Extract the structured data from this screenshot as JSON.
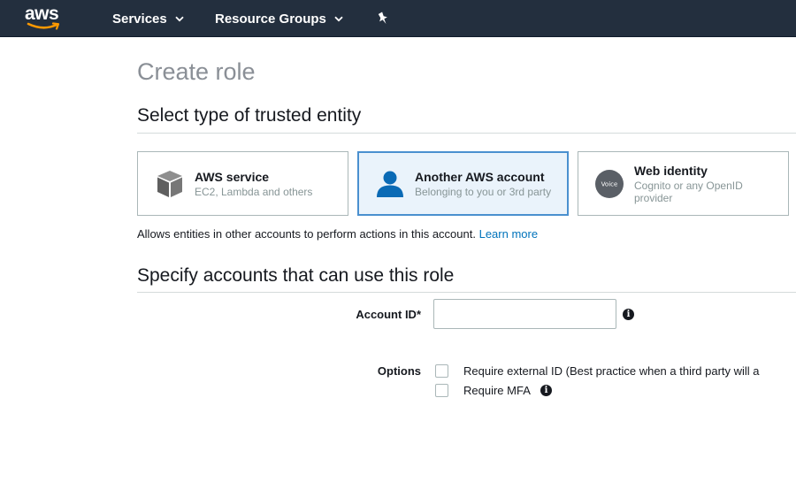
{
  "nav": {
    "logo_text": "aws",
    "services_label": "Services",
    "resource_groups_label": "Resource Groups"
  },
  "page": {
    "title": "Create role"
  },
  "trusted_entity": {
    "heading": "Select type of trusted entity",
    "cards": [
      {
        "title": "AWS service",
        "subtitle": "EC2, Lambda and others",
        "selected": false
      },
      {
        "title": "Another AWS account",
        "subtitle": "Belonging to you or 3rd party",
        "selected": true
      },
      {
        "title": "Web identity",
        "subtitle": "Cognito or any OpenID provider",
        "selected": false
      }
    ],
    "description": "Allows entities in other accounts to perform actions in this account.",
    "learn_more": "Learn more"
  },
  "accounts": {
    "heading": "Specify accounts that can use this role",
    "account_id_label": "Account ID*",
    "account_id_value": "",
    "options_label": "Options",
    "options": [
      {
        "label": "Require external ID (Best practice when a third party will a",
        "checked": false
      },
      {
        "label": "Require MFA",
        "checked": false
      }
    ]
  },
  "icons": {
    "info_glyph": "i",
    "web_identity_badge": "Voice"
  },
  "colors": {
    "nav_bg": "#232f3e",
    "selected_border": "#4a90cf",
    "selected_bg": "#eaf3fb",
    "link": "#0073bb",
    "account_icon": "#0a6ab5"
  }
}
